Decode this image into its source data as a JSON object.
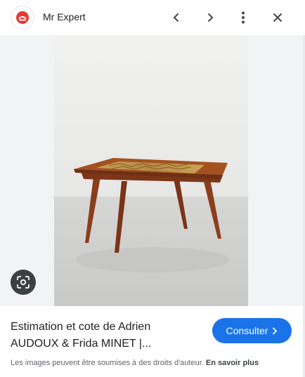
{
  "header": {
    "site_name": "Mr Expert",
    "icons": [
      "site-logo",
      "chevron-left-icon",
      "chevron-right-icon",
      "more-vertical-icon",
      "close-icon"
    ]
  },
  "image": {
    "lens_icon": "google-lens-icon"
  },
  "result": {
    "title": "Estimation et cote de Adrien AUDOUX & Frida MINET |...",
    "button_label": "Consulter",
    "button_icon": "chevron-right-icon",
    "copyright_text": "Les images peuvent être soumises à des droits d'auteur.",
    "learn_more": "En savoir plus"
  },
  "colors": {
    "accent": "#1a73e8",
    "logo_red": "#e53935"
  }
}
